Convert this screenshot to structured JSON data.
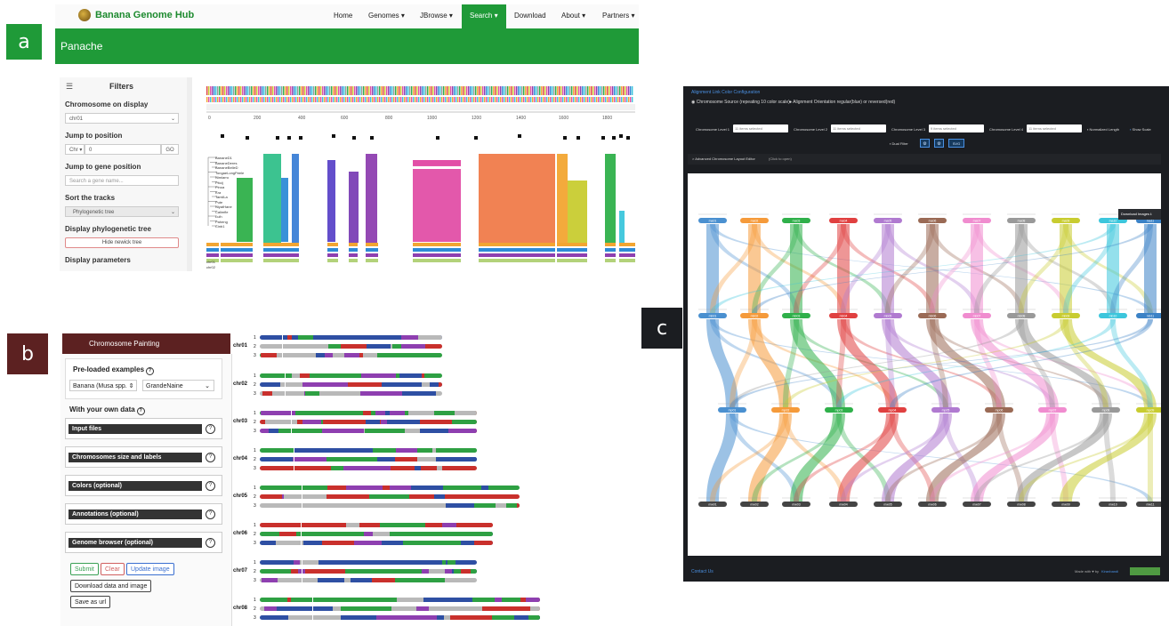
{
  "panel_labels": {
    "a": "a",
    "b": "b",
    "c": "c"
  },
  "panel_a": {
    "brand": "Banana Genome Hub",
    "nav": [
      "Home",
      "Genomes ▾",
      "JBrowse ▾",
      "Search ▾",
      "Download",
      "About ▾",
      "Partners ▾"
    ],
    "page_title": "Panache",
    "filters_title": "Filters",
    "chrom_label": "Chromosome on display",
    "chrom_value": "chr01",
    "jump_pos_label": "Jump to position",
    "jump_chr": "Chr ▾",
    "jump_value": "0",
    "go": "GO",
    "jump_gene_label": "Jump to gene position",
    "gene_placeholder": "Search a gene name...",
    "sort_label": "Sort the tracks",
    "sort_value": "Phylogenetic tree",
    "phylo_label": "Display phylogenetic tree",
    "hide_tree": "Hide newick tree",
    "display_params": "Display parameters",
    "ruler_ticks": [
      "0",
      "200",
      "400",
      "600",
      "800",
      "1000",
      "1200",
      "1400",
      "1600",
      "1800"
    ],
    "tree_labels": [
      "BananeD1",
      "BananeDeres",
      "BananeBelleD",
      "TongaeLongPeele",
      "Nimlarro",
      "Pitoij",
      "Pinoa",
      "Kra",
      "TamilLa",
      "Pute",
      "NiyatHane",
      "Calimfle",
      "Luih",
      "Paheng",
      "Cinb1"
    ],
    "bottom_labels": [
      "chr01",
      "chr02"
    ],
    "colors": {
      "green": "#1f9a38"
    }
  },
  "panel_b": {
    "header": "Chromosome Painting",
    "preloaded_label": "Pre-loaded examples",
    "species_value": "Banana (Musa spp.",
    "cultivar_value": "GrandeNaine",
    "own_data_label": "With your own data",
    "accordions": [
      "Input files",
      "Chromosomes size and labels",
      "Colors (optional)",
      "Annotations (optional)",
      "Genome browser (optional)"
    ],
    "buttons": {
      "submit": "Submit",
      "clear": "Clear",
      "update": "Update image",
      "download": "Download data and image",
      "save": "Save as url"
    },
    "chromosomes": [
      "chr01",
      "chr02",
      "chr03",
      "chr04",
      "chr05",
      "chr06",
      "chr07",
      "chr08"
    ],
    "haplotype_numbers": [
      "1",
      "2",
      "3"
    ],
    "colors": {
      "header": "#5c2121",
      "blue": "#2e4fa3",
      "green": "#2ea043",
      "red": "#c9302c",
      "purple": "#8e3fb0",
      "grey": "#b9b9b9"
    }
  },
  "panel_c": {
    "config_link": "Alignment Link Color Configuration",
    "radio1": "Chromosome Source (repeating 10 color scale)",
    "radio2": "Alignment Orientation regular(blue) or reversed(red)",
    "levels": [
      "Chromosome Level 1",
      "Chromosome Level 2",
      "Chromosome Level 3",
      "Chromosome Level 4"
    ],
    "level_values": [
      "11 items selected",
      "11 items selected",
      "9 items selected",
      "11 items selected"
    ],
    "normalized": "Normalized Length",
    "show_scale": "Show Scale",
    "dual_filter": "Dual Filter",
    "svg_btn": "SVG",
    "advanced": "> Advanced Chromosome Layout Editor",
    "click_to_open": "(Click to open)",
    "download_images": "Download Images",
    "contact": "Contact Us",
    "made_with": "Made with ♥ by",
    "author": "Kiranbandi",
    "rows": [
      {
        "labels": [
          "ma01",
          "ma02",
          "ma03",
          "ma04",
          "ma05",
          "ma06",
          "ma07",
          "ma08",
          "ma09",
          "ma10",
          "ma11"
        ]
      },
      {
        "labels": [
          "mb01",
          "mb02",
          "mb03",
          "mb04",
          "mb05",
          "mb06",
          "mb07",
          "mb08",
          "mb09",
          "mb10",
          "mb11"
        ]
      },
      {
        "labels": [
          "mp01",
          "mp02",
          "mp03",
          "mp04",
          "mp05",
          "mp06",
          "mp07",
          "mp08",
          "mp09"
        ]
      },
      {
        "labels": [
          "mw01",
          "mw02",
          "mw03",
          "mw04",
          "mw05",
          "mw06",
          "mw07",
          "mw08",
          "mw09",
          "mw10",
          "mw11"
        ]
      }
    ],
    "palette": [
      "#4a90d0",
      "#f59a3a",
      "#2fb04a",
      "#e04040",
      "#b07ad0",
      "#9a6a55",
      "#f08ccf",
      "#999999",
      "#c8cc30",
      "#3cc6dc",
      "#3b82c6"
    ]
  }
}
